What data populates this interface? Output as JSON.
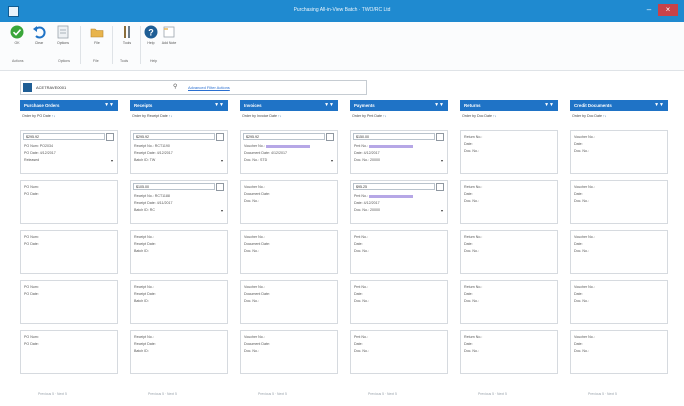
{
  "window": {
    "title": "Purchasing All-in-View Batch · TWO/RC Ltd"
  },
  "ribbon": {
    "buttons": [
      {
        "label": "OK",
        "icon": "ok-check-icon"
      },
      {
        "label": "Clear",
        "icon": "clear-undo-icon"
      },
      {
        "label": "Options",
        "icon": "options-icon"
      },
      {
        "label": "File",
        "icon": "file-folder-icon"
      },
      {
        "label": "Tools",
        "icon": "tools-icon"
      },
      {
        "label": "Help",
        "icon": "help-icon"
      },
      {
        "label": "Add Note",
        "icon": "add-note-icon"
      }
    ],
    "groups": [
      "Actions",
      "Options",
      "File",
      "Tools",
      "Help"
    ]
  },
  "search": {
    "vendor": "ACETRAVE0001",
    "advanced_link": "Advanced Filter Actions"
  },
  "columns": [
    {
      "title": "Purchase Orders",
      "order": "Order by PO Date",
      "cards": [
        {
          "amount": "$295.92",
          "lines": [
            "PO Num: PO2034",
            "PO Date: 4/12/2017"
          ],
          "select": "Released"
        },
        {
          "lines": [
            "PO Num:",
            "PO Date:"
          ]
        },
        {
          "lines": [
            "PO Num:",
            "PO Date:"
          ]
        },
        {
          "lines": [
            "PO Num:",
            "PO Date:"
          ]
        },
        {
          "lines": [
            "PO Num:",
            "PO Date:"
          ]
        }
      ],
      "pager": "Previous 5 · Next 5"
    },
    {
      "title": "Receipts",
      "order": "Order by Receipt Date",
      "cards": [
        {
          "amount": "$295.92",
          "lines": [
            "Receipt No.: RCT1190",
            "Receipt Date: 4/12/2017"
          ],
          "select": "Batch ID: TW"
        },
        {
          "amount": "$105.00",
          "lines": [
            "Receipt No.: RCT1188",
            "Receipt Date: 4/11/2017"
          ],
          "select": "Batch ID: RC"
        },
        {
          "lines": [
            "Receipt No.:",
            "Receipt Date:",
            "Batch ID:"
          ]
        },
        {
          "lines": [
            "Receipt No.:",
            "Receipt Date:",
            "Batch ID:"
          ]
        },
        {
          "lines": [
            "Receipt No.:",
            "Receipt Date:",
            "Batch ID:"
          ]
        }
      ],
      "pager": "Previous 5 · Next 5"
    },
    {
      "title": "Invoices",
      "order": "Order by Invoice Date",
      "cards": [
        {
          "amount": "$295.92",
          "lines": [
            "Voucher No.:",
            "Document Date: 4/12/2017"
          ],
          "select": "Doc. No.: STD"
        },
        {
          "lines": [
            "Voucher No.:",
            "Document Date:",
            "Doc. No.:"
          ]
        },
        {
          "lines": [
            "Voucher No.:",
            "Document Date:",
            "Doc. No.:"
          ]
        },
        {
          "lines": [
            "Voucher No.:",
            "Document Date:",
            "Doc. No.:"
          ]
        },
        {
          "lines": [
            "Voucher No.:",
            "Document Date:",
            "Doc. No.:"
          ]
        }
      ],
      "pager": "Previous 5 · Next 5"
    },
    {
      "title": "Payments",
      "order": "Order by Pmt Date",
      "cards": [
        {
          "amount": "$150.00",
          "lines": [
            "Pmt No.:",
            "Date: 4/12/2017"
          ],
          "select": "Doc. No.: 20000"
        },
        {
          "amount": "$95.25",
          "lines": [
            "Pmt No.:",
            "Date: 4/12/2017"
          ],
          "select": "Doc. No.: 20000"
        },
        {
          "lines": [
            "Pmt No.:",
            "Date:",
            "Doc. No.:"
          ]
        },
        {
          "lines": [
            "Pmt No.:",
            "Date:",
            "Doc. No.:"
          ]
        },
        {
          "lines": [
            "Pmt No.:",
            "Date:",
            "Doc. No.:"
          ]
        }
      ],
      "pager": "Previous 5 · Next 5"
    },
    {
      "title": "Returns",
      "order": "Order by Doc Date",
      "cards": [
        {
          "lines": [
            "Return No.:",
            "Date:",
            "Doc. No.:"
          ]
        },
        {
          "lines": [
            "Return No.:",
            "Date:",
            "Doc. No.:"
          ]
        },
        {
          "lines": [
            "Return No.:",
            "Date:",
            "Doc. No.:"
          ]
        },
        {
          "lines": [
            "Return No.:",
            "Date:",
            "Doc. No.:"
          ]
        },
        {
          "lines": [
            "Return No.:",
            "Date:",
            "Doc. No.:"
          ]
        }
      ],
      "pager": "Previous 5 · Next 5"
    },
    {
      "title": "Credit Documents",
      "order": "Order by Doc Date",
      "cards": [
        {
          "lines": [
            "Voucher No.:",
            "Date:",
            "Doc. No.:"
          ]
        },
        {
          "lines": [
            "Voucher No.:",
            "Date:",
            "Doc. No.:"
          ]
        },
        {
          "lines": [
            "Voucher No.:",
            "Date:",
            "Doc. No.:"
          ]
        },
        {
          "lines": [
            "Voucher No.:",
            "Date:",
            "Doc. No.:"
          ]
        },
        {
          "lines": [
            "Voucher No.:",
            "Date:",
            "Doc. No.:"
          ]
        }
      ],
      "pager": "Previous 5 · Next 5"
    }
  ],
  "colors": {
    "accent": "#1f73c6",
    "titlebar": "#1f8ad0"
  }
}
